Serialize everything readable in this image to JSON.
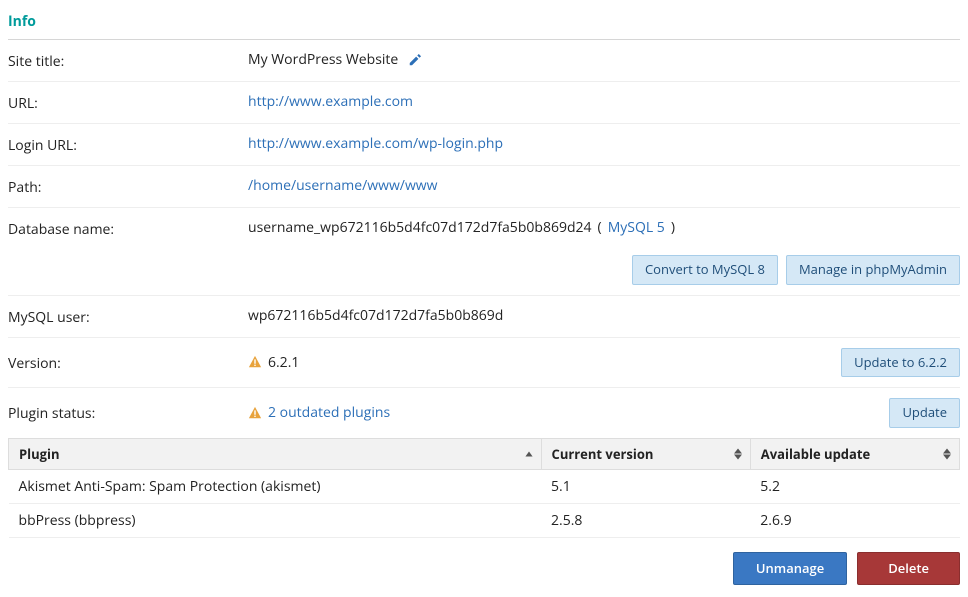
{
  "section_title": "Info",
  "labels": {
    "site_title": "Site title:",
    "url": "URL:",
    "login_url": "Login URL:",
    "path": "Path:",
    "database_name": "Database name:",
    "mysql_user": "MySQL user:",
    "version": "Version:",
    "plugin_status": "Plugin status:"
  },
  "values": {
    "site_title": "My WordPress Website",
    "url": "http://www.example.com",
    "login_url": "http://www.example.com/wp-login.php",
    "path": "/home/username/www/www",
    "database_name": "username_wp672116b5d4fc07d172d7fa5b0b869d24",
    "database_engine": "MySQL 5",
    "mysql_user": "wp672116b5d4fc07d172d7fa5b0b869d",
    "version": "6.2.1",
    "plugin_status": "2 outdated plugins"
  },
  "buttons": {
    "convert_mysql": "Convert to MySQL 8",
    "manage_pma": "Manage in phpMyAdmin",
    "update_version": "Update to 6.2.2",
    "update_plugins": "Update",
    "unmanage": "Unmanage",
    "delete": "Delete"
  },
  "table": {
    "headers": {
      "plugin": "Plugin",
      "current": "Current version",
      "available": "Available update"
    },
    "rows": [
      {
        "plugin": "Akismet Anti-Spam: Spam Protection (akismet)",
        "current": "5.1",
        "available": "5.2"
      },
      {
        "plugin": "bbPress (bbpress)",
        "current": "2.5.8",
        "available": "2.6.9"
      }
    ]
  }
}
